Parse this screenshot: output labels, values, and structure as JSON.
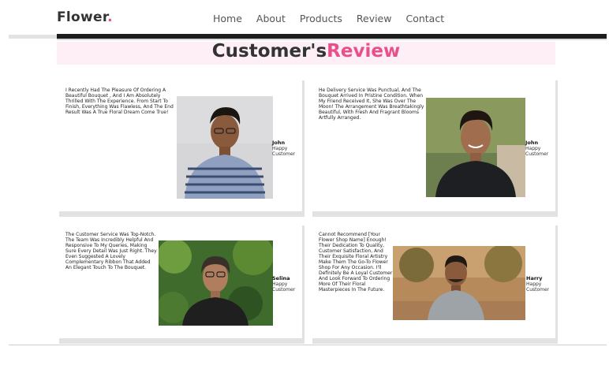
{
  "brand": {
    "name": "Flower",
    "dot": "."
  },
  "nav": [
    "Home",
    "About",
    "Products",
    "Review",
    "Contact"
  ],
  "section": {
    "title_part1": "Customer's",
    "title_part2": "Review"
  },
  "reviews": [
    {
      "text": "I Recently Had The Pleasure Of Ordering A Beautiful Bouquet , And I Am Absolutely Thrilled With The Experience. From Start To Finish, Everything Was Flawless, And The End Result Was A True Floral Dream Come True!",
      "name": "John",
      "role": "Happy Customer"
    },
    {
      "text": "He Delivery Service Was Punctual, And The Bouquet Arrived In Pristine Condition. When My Friend Received It, She Was Over The Moon! The Arrangement Was Breathtakingly Beautiful, With Fresh And Fragrant Blooms Artfully Arranged.",
      "name": "John",
      "role": "Happy Customer"
    },
    {
      "text": "The Customer Service Was Top-Notch. The Team Was Incredibly Helpful And Responsive To My Queries, Making Sure Every Detail Was Just Right. They Even Suggested A Lovely Complementary Ribbon That Added An Elegant Touch To The Bouquet.",
      "name": "Selina",
      "role": "Happy Customer"
    },
    {
      "text": "Cannot Recommend [Your Flower Shop Name] Enough! Their Dedication To Quality, Customer Satisfaction, And Their Exquisite Floral Artistry Make Them The Go-To Flower Shop For Any Occasion. I'll Definitely Be A Loyal Customer And Look Forward To Ordering More Of Their Floral Masterpieces In The Future.",
      "name": "Harry",
      "role": "Happy Customer"
    }
  ]
}
